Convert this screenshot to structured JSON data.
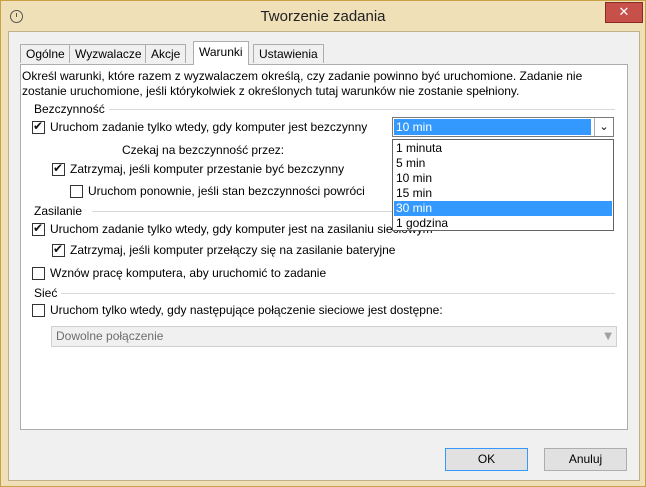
{
  "window": {
    "title": "Tworzenie zadania",
    "close_glyph": "✕"
  },
  "tabs": [
    "Ogólne",
    "Wyzwalacze",
    "Akcje",
    "Warunki",
    "Ustawienia"
  ],
  "active_tab": "Warunki",
  "description": "Określ warunki, które razem z wyzwalaczem określą, czy zadanie powinno być uruchomione. Zadanie nie zostanie uruchomione, jeśli którykolwiek z określonych tutaj warunków nie zostanie spełniony.",
  "idle": {
    "section_label": "Bezczynność",
    "start_only_idle": {
      "label": "Uruchom zadanie tylko wtedy, gdy komputer jest bezczynny",
      "checked": true
    },
    "idle_for": {
      "selected": "10 min",
      "options": [
        "1 minuta",
        "5 min",
        "10 min",
        "15 min",
        "30 min",
        "1 godzina"
      ],
      "highlighted": "30 min"
    },
    "wait_label": "Czekaj na bezczynność przez:",
    "stop_if_not_idle": {
      "label": "Zatrzymaj, jeśli komputer przestanie być bezczynny",
      "checked": true
    },
    "restart_if_idle": {
      "label": "Uruchom ponownie, jeśli stan bezczynności powróci",
      "checked": false
    }
  },
  "power": {
    "section_label": "Zasilanie",
    "ac_only": {
      "label": "Uruchom zadanie tylko wtedy, gdy komputer jest na zasilaniu sieciowym",
      "checked": true
    },
    "stop_on_battery": {
      "label": "Zatrzymaj, jeśli komputer przełączy się na zasilanie bateryjne",
      "checked": true
    },
    "wake": {
      "label": "Wznów pracę komputera, aby uruchomić to zadanie",
      "checked": false
    }
  },
  "network": {
    "section_label": "Sieć",
    "start_if_available": {
      "label": "Uruchom tylko wtedy, gdy następujące połączenie sieciowe jest dostępne:",
      "checked": false
    },
    "connection": "Dowolne połączenie"
  },
  "buttons": {
    "ok": "OK",
    "cancel": "Anuluj"
  },
  "colors": {
    "titlebar": "#f0e0b8",
    "selection": "#3399ff",
    "close": "#c7504b"
  }
}
